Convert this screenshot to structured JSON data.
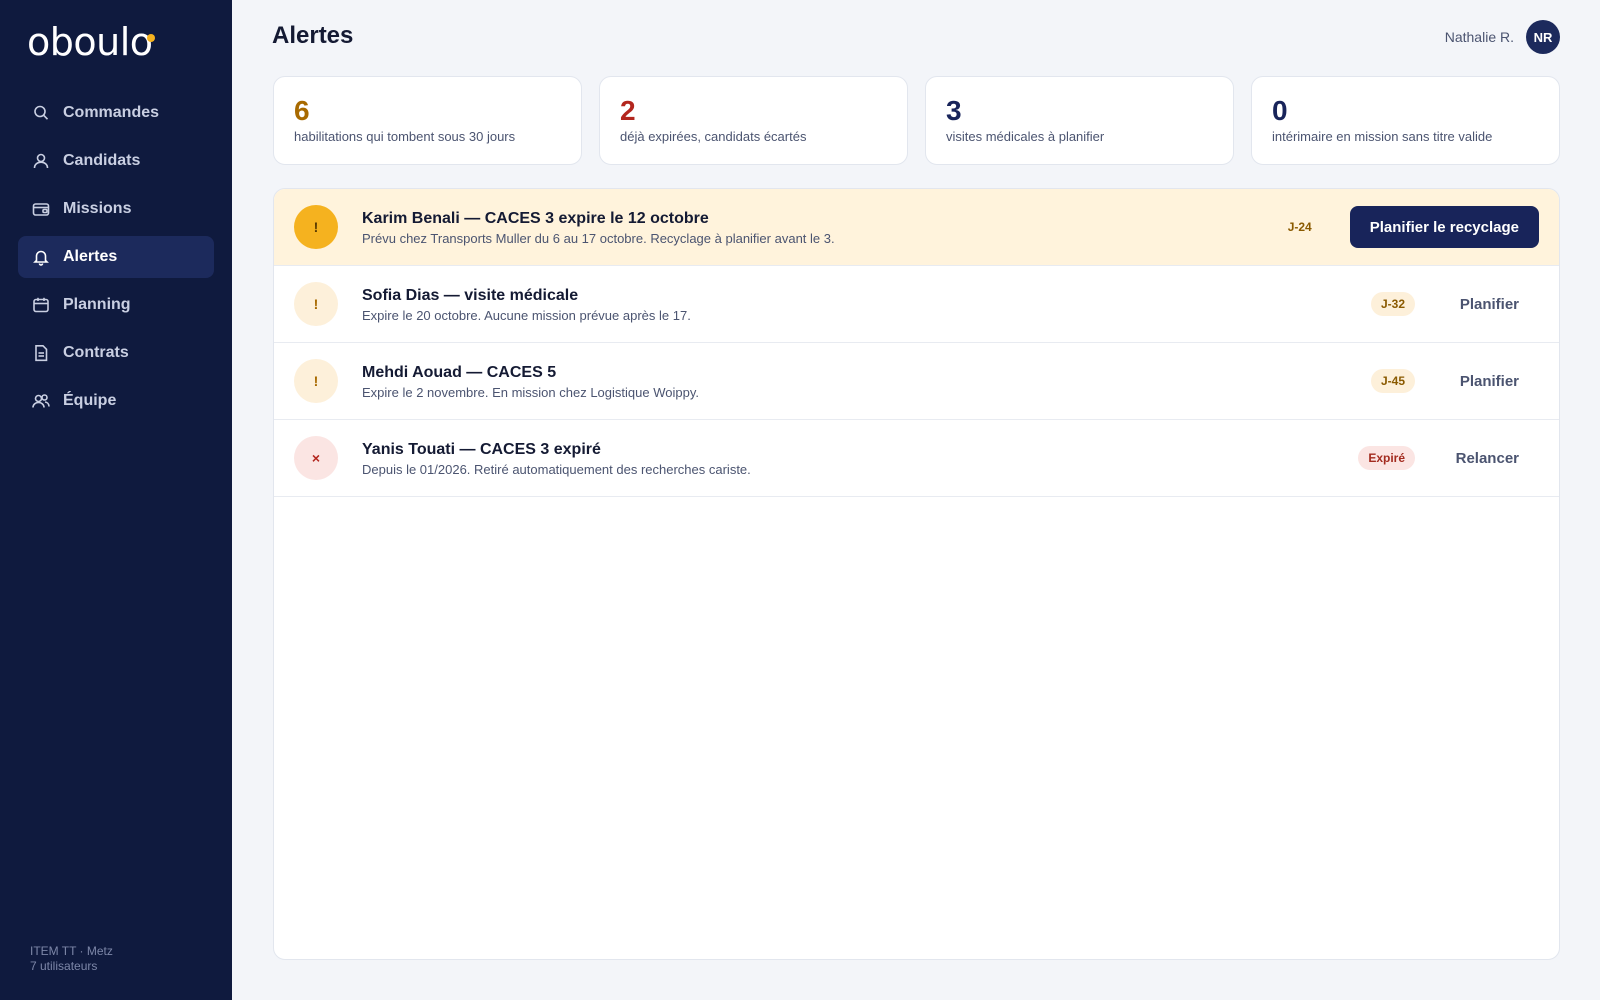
{
  "brand": {
    "name": "oboulo",
    "accent": "#f5b21f"
  },
  "sidebar": {
    "items": [
      {
        "label": "Commandes",
        "icon": "search-person-icon"
      },
      {
        "label": "Candidats",
        "icon": "user-icon"
      },
      {
        "label": "Missions",
        "icon": "wallet-icon"
      },
      {
        "label": "Alertes",
        "icon": "bell-icon",
        "active": true
      },
      {
        "label": "Planning",
        "icon": "calendar-icon"
      },
      {
        "label": "Contrats",
        "icon": "document-icon"
      },
      {
        "label": "Équipe",
        "icon": "users-icon"
      }
    ],
    "footer": {
      "agency": "ITEM TT · Metz",
      "users": "7 utilisateurs"
    }
  },
  "header": {
    "title": "Alertes",
    "user_name": "Nathalie R.",
    "user_initials": "NR"
  },
  "stats": [
    {
      "value": "6",
      "label": "habilitations qui tombent sous 30 jours",
      "color": "#a86a00"
    },
    {
      "value": "2",
      "label": "déjà expirées, candidats écartés",
      "color": "#b3261e"
    },
    {
      "value": "3",
      "label": "visites médicales à planifier",
      "color": "#18245a"
    },
    {
      "value": "0",
      "label": "intérimaire en mission sans titre valide",
      "color": "#18245a"
    }
  ],
  "alerts": [
    {
      "icon": "!",
      "title": "Karim Benali — CACES 3 expire le 12 octobre",
      "desc": "Prévu chez Transports Muller du 6 au 17 octobre. Recyclage à planifier avant le 3.",
      "badge": "J-24",
      "action": "Planifier le recyclage"
    },
    {
      "icon": "!",
      "title": "Sofia Dias — visite médicale",
      "desc": "Expire le 20 octobre. Aucune mission prévue après le 17.",
      "badge": "J-32",
      "action": "Planifier"
    },
    {
      "icon": "!",
      "title": "Mehdi Aouad — CACES 5",
      "desc": "Expire le 2 novembre. En mission chez Logistique Woippy.",
      "badge": "J-45",
      "action": "Planifier"
    },
    {
      "icon": "×",
      "title": "Yanis Touati — CACES 3 expiré",
      "desc": "Depuis le 01/2026. Retiré automatiquement des recherches cariste.",
      "badge": "Expiré",
      "action": "Relancer"
    }
  ]
}
